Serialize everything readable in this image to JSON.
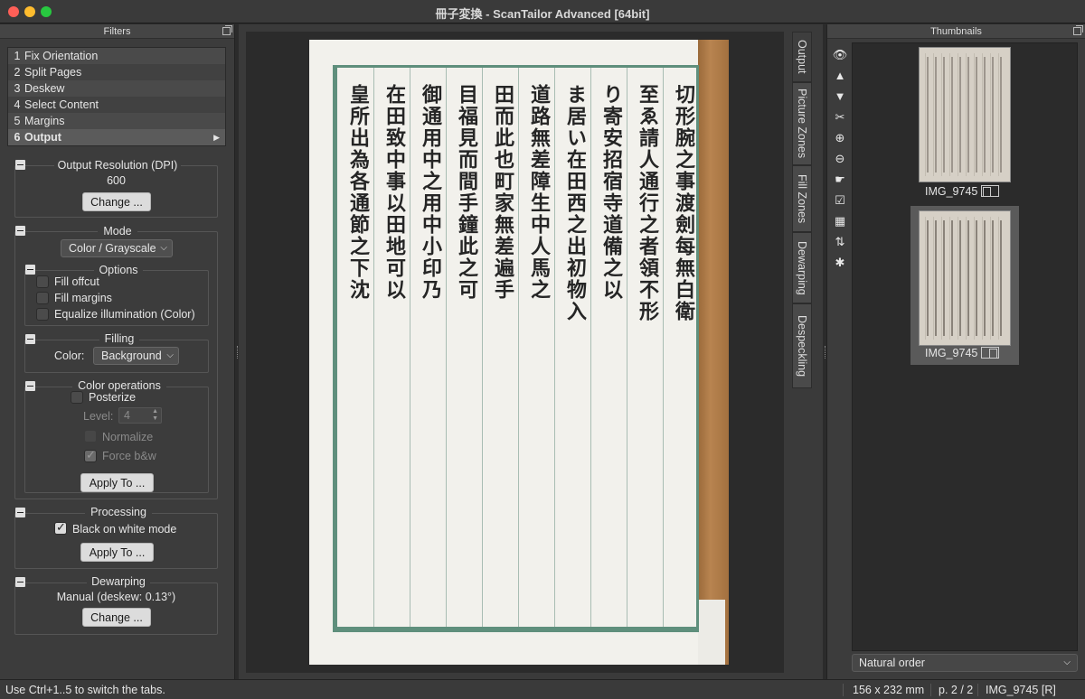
{
  "window": {
    "title": "冊子変換 - ScanTailor Advanced [64bit]"
  },
  "filters_panel": {
    "header": "Filters",
    "stages": [
      {
        "num": "1",
        "label": "Fix Orientation"
      },
      {
        "num": "2",
        "label": "Split Pages"
      },
      {
        "num": "3",
        "label": "Deskew"
      },
      {
        "num": "4",
        "label": "Select Content"
      },
      {
        "num": "5",
        "label": "Margins"
      },
      {
        "num": "6",
        "label": "Output",
        "arrow": "▶"
      }
    ],
    "output_resolution": {
      "title": "Output Resolution (DPI)",
      "value": "600",
      "change_label": "Change ..."
    },
    "mode": {
      "title": "Mode",
      "selected": "Color / Grayscale",
      "options": {
        "title": "Options",
        "fill_offcut": "Fill offcut",
        "fill_margins": "Fill margins",
        "equalize": "Equalize illumination (Color)"
      },
      "filling": {
        "title": "Filling",
        "color_label": "Color:",
        "color_value": "Background"
      },
      "color_ops": {
        "title": "Color operations",
        "posterize": "Posterize",
        "level_label": "Level:",
        "level_value": "4",
        "normalize": "Normalize",
        "force_bw": "Force b&w"
      },
      "apply_label": "Apply To ..."
    },
    "processing": {
      "title": "Processing",
      "black_on_white": "Black on white mode",
      "apply_label": "Apply To ..."
    },
    "dewarping": {
      "title": "Dewarping",
      "value": "Manual (deskew: 0.13°)",
      "change_label": "Change ..."
    }
  },
  "view_tabs": [
    "Output",
    "Picture Zones",
    "Fill Zones",
    "Dewarping",
    "Despeckling"
  ],
  "document": {
    "columns": [
      "切形腕之事渡劍每無白衛",
      "至ゑ請人通行之者領不形",
      "り寄安招宿寺道備之以",
      "ま居い在田西之出初物入",
      "道路無差障生中人馬之",
      "田而此也町家無差遍手",
      "目福見而間手鐘此之可",
      "御通用中之用中小印乃",
      "在田致中事以田地可以",
      "皇所出為各通節之下沈"
    ]
  },
  "thumbnails_panel": {
    "header": "Thumbnails",
    "tools": [
      "eye-icon",
      "up-icon",
      "down-icon",
      "cut-icon",
      "zoom-in-icon",
      "zoom-out-icon",
      "pointer-icon",
      "check-icon",
      "grid-icon",
      "sort-icon",
      "asterisk-icon"
    ],
    "tool_glyphs": [
      "👁",
      "▲",
      "▼",
      "✂",
      "⊕",
      "⊖",
      "☛",
      "☑",
      "▦",
      "⇅",
      "✱"
    ],
    "items": [
      {
        "caption": "IMG_9745"
      },
      {
        "caption": "IMG_9745"
      }
    ],
    "sort_selected": "Natural order"
  },
  "status_bar": {
    "hint": "Use Ctrl+1..5 to switch the tabs.",
    "size": "156 x 232 mm",
    "page": "p. 2 / 2",
    "file": "IMG_9745 [R]"
  },
  "colors": {
    "frame_green": "#5f8f7c",
    "wood": "#b88450",
    "panel_bg": "#3c3c3c"
  }
}
